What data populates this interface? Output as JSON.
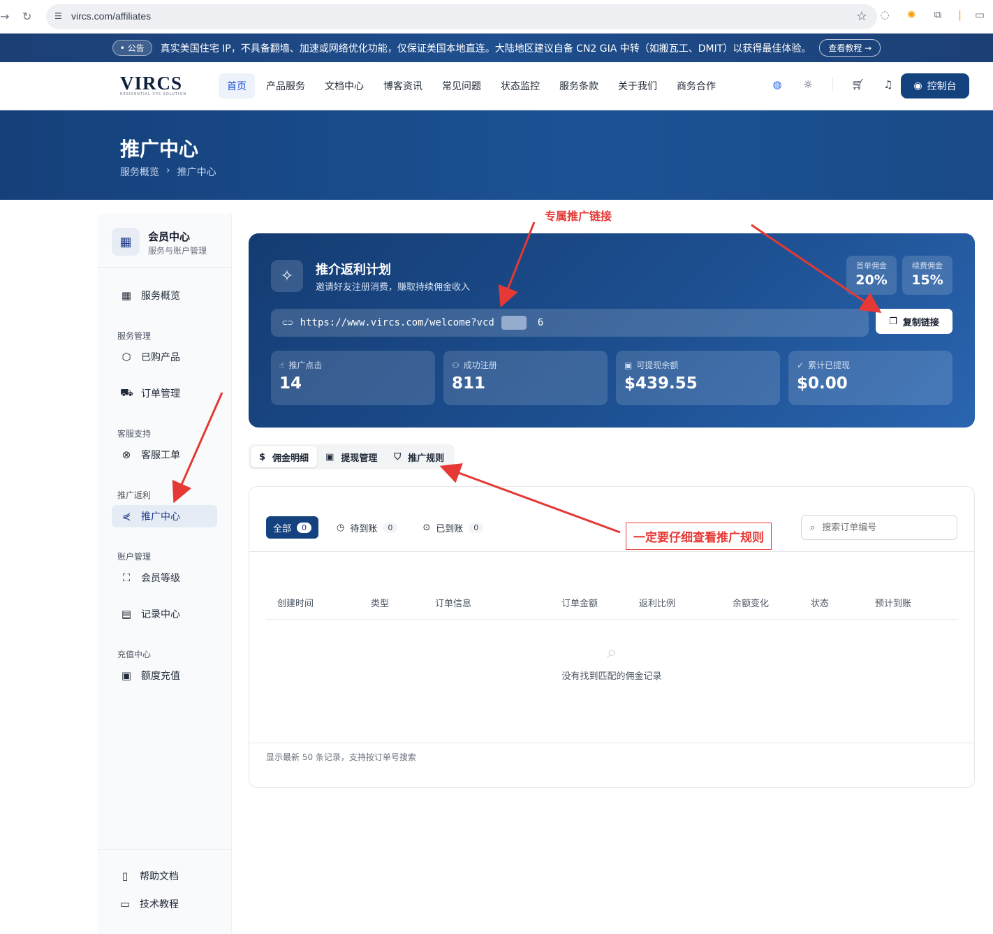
{
  "browser": {
    "url": "vircs.com/affiliates"
  },
  "announcement": {
    "tag": "• 公告",
    "text": "真实美国住宅 IP，不具备翻墙、加速或网络优化功能，仅保证美国本地直连。大陆地区建议自备 CN2 GIA 中转（如搬瓦工、DMIT）以获得最佳体验。",
    "button": "查看教程 →"
  },
  "header": {
    "logo": "VIRCS",
    "logo_sub": "RESIDENTIAL VPS SOLUTION",
    "nav": [
      "首页",
      "产品服务",
      "文档中心",
      "博客资讯",
      "常见问题",
      "状态监控",
      "服务条款",
      "关于我们",
      "商务合作"
    ],
    "console": "控制台"
  },
  "hero": {
    "title": "推广中心",
    "crumb_parent": "服务概览",
    "crumb_sep": "›",
    "crumb_current": "推广中心"
  },
  "sidebar": {
    "title": "会员中心",
    "subtitle": "服务与账户管理",
    "overview": "服务概览",
    "groups": {
      "service": "服务管理",
      "support": "客服支持",
      "affiliate": "推广返利",
      "account": "账户管理",
      "recharge": "充值中心"
    },
    "items": {
      "products": "已购产品",
      "orders": "订单管理",
      "tickets": "客服工单",
      "affiliate": "推广中心",
      "level": "会员等级",
      "records": "记录中心",
      "topup": "额度充值"
    },
    "footer": {
      "help": "帮助文档",
      "tutorial": "技术教程"
    }
  },
  "referral": {
    "title": "推介返利计划",
    "subtitle": "邀请好友注册消费，赚取持续佣金收入",
    "first_label": "首单佣金",
    "first_value": "20%",
    "renew_label": "续费佣金",
    "renew_value": "15%",
    "link_prefix": "https://www.vircs.com/welcome?vcd",
    "link_suffix": "6",
    "copy_button": "复制链接",
    "stats": [
      {
        "label": "推广点击",
        "value": "14"
      },
      {
        "label": "成功注册",
        "value": "811"
      },
      {
        "label": "可提现余额",
        "value": "$439.55"
      },
      {
        "label": "累计已提现",
        "value": "$0.00"
      }
    ]
  },
  "tabs": [
    "佣金明细",
    "提现管理",
    "推广规则"
  ],
  "table": {
    "filters": [
      {
        "label": "全部",
        "count": "0"
      },
      {
        "label": "待到账",
        "count": "0"
      },
      {
        "label": "已到账",
        "count": "0"
      }
    ],
    "search_placeholder": "搜索订单编号",
    "columns": [
      "创建时间",
      "类型",
      "订单信息",
      "订单金额",
      "返利比例",
      "余额变化",
      "状态",
      "预计到账"
    ],
    "empty_text": "没有找到匹配的佣金记录",
    "footer_note": "显示最新 50 条记录，支持按订单号搜索"
  },
  "annotations": {
    "link_note": "专属推广链接",
    "rules_note": "一定要仔细查看推广规则"
  }
}
